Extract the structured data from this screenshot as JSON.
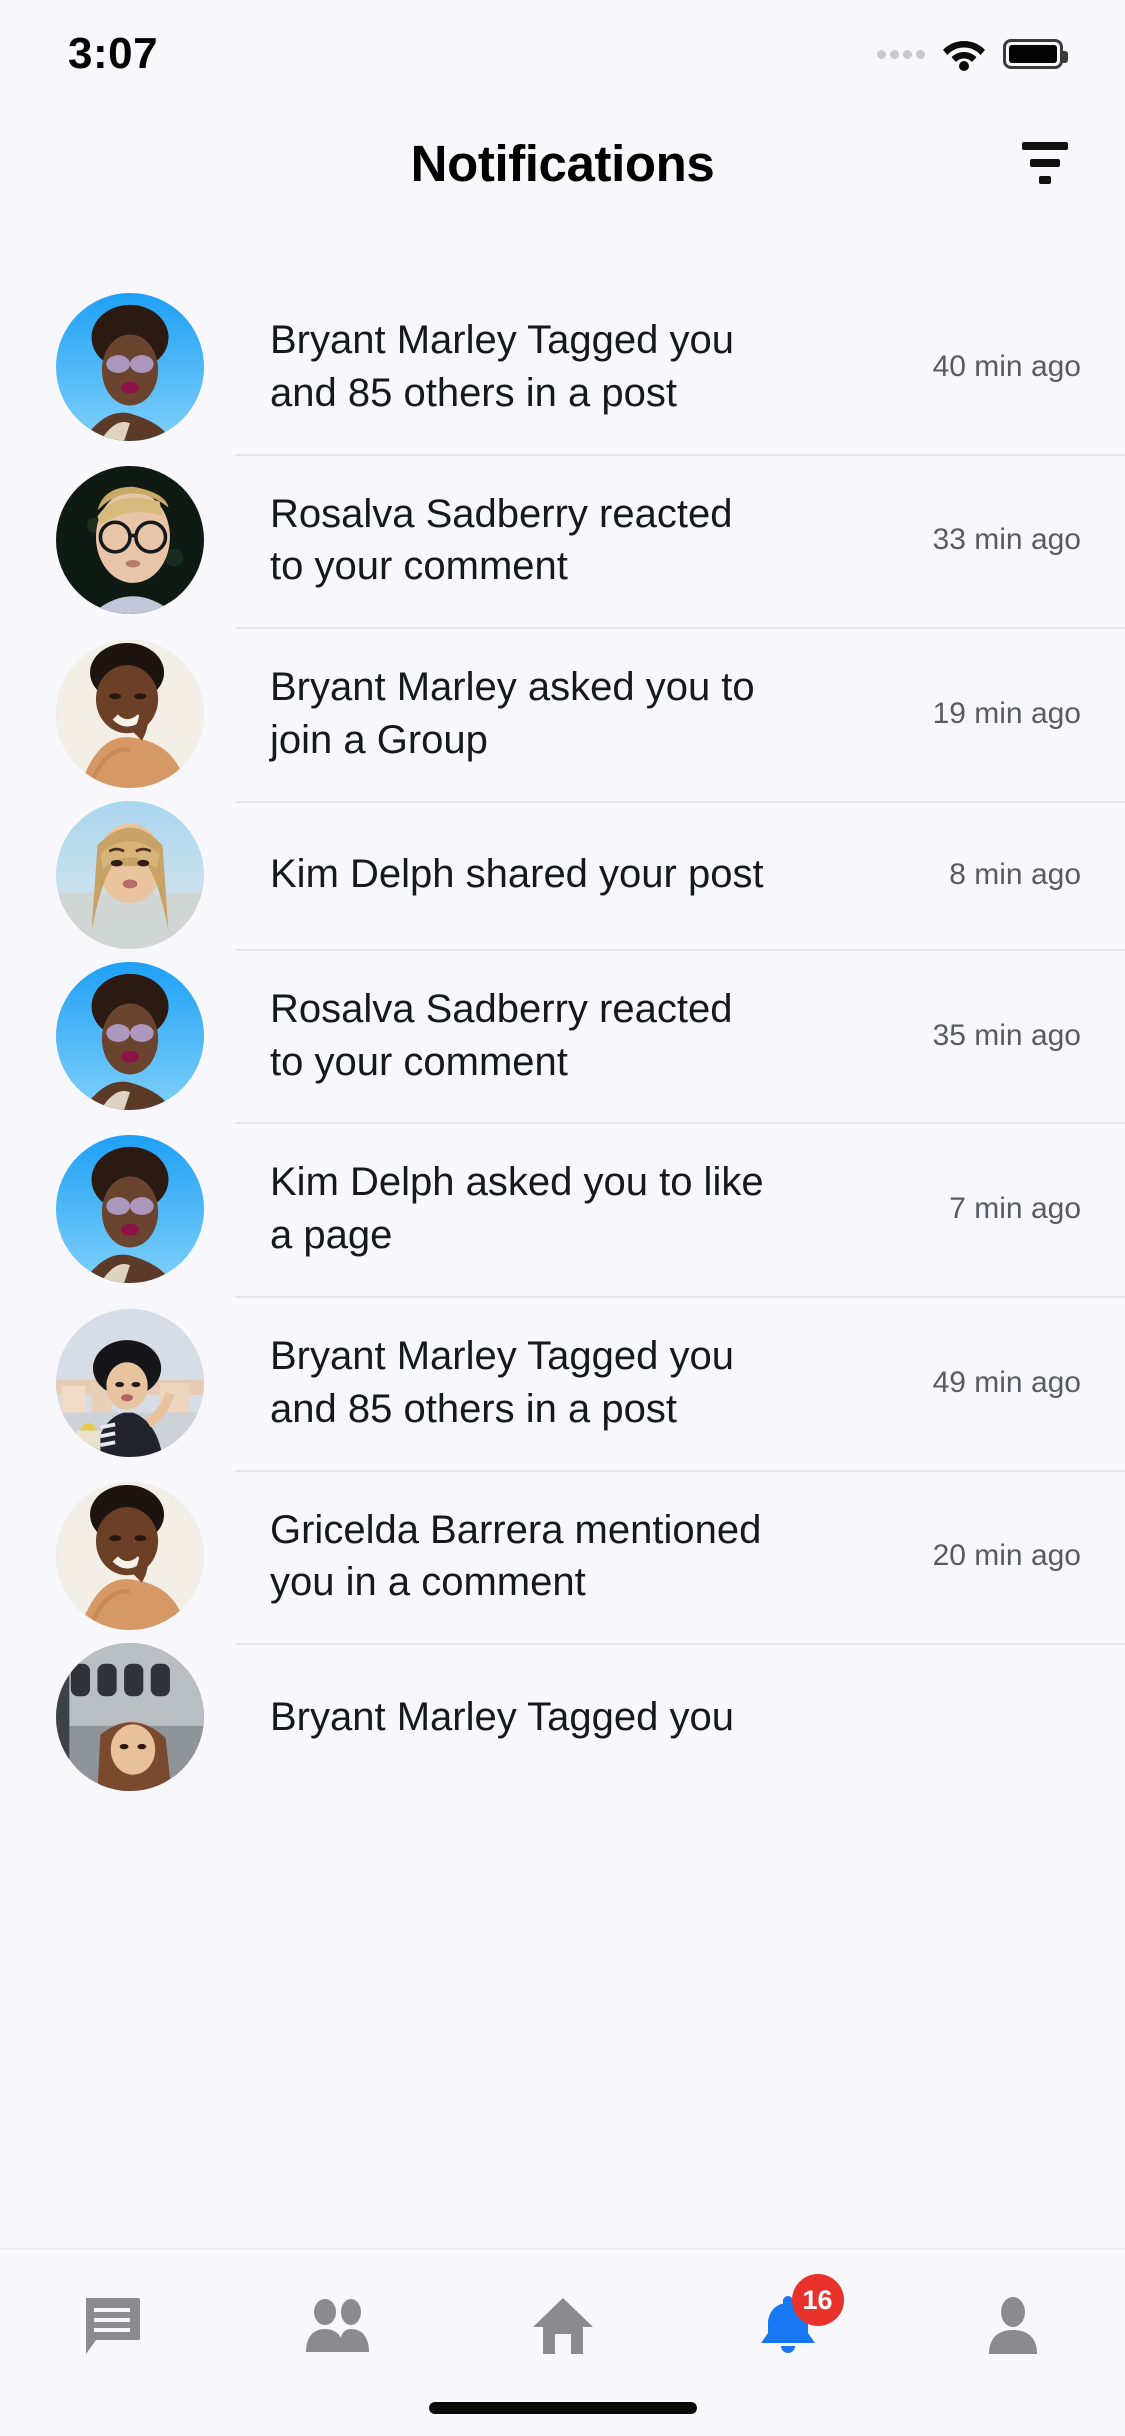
{
  "status_bar": {
    "time": "3:07",
    "signal_icon": "signal-dots-icon",
    "wifi_icon": "wifi-icon",
    "battery_icon": "battery-full-icon"
  },
  "header": {
    "title": "Notifications",
    "filter_icon": "filter-icon"
  },
  "notifications": [
    {
      "text": "Bryant Marley Tagged you and 85 others in a post",
      "time": "40 min ago",
      "avatar": "woman-sunglasses-blue-sky"
    },
    {
      "text": "Rosalva Sadberry reacted to your comment",
      "time": "33 min ago",
      "avatar": "man-glasses-dark-bg"
    },
    {
      "text": "Bryant Marley asked you to join a Group",
      "time": "19 min ago",
      "avatar": "woman-tan-sweater-cream-bg"
    },
    {
      "text": "Kim Delph shared your post",
      "time": "8 min ago",
      "avatar": "woman-long-blonde-hair-blue-bg"
    },
    {
      "text": "Rosalva Sadberry reacted to your comment",
      "time": "35 min ago",
      "avatar": "woman-sunglasses-blue-sky"
    },
    {
      "text": "Kim Delph asked you to like a page",
      "time": "7 min ago",
      "avatar": "woman-sunglasses-blue-sky"
    },
    {
      "text": "Bryant Marley Tagged you and 85 others in a post",
      "time": "49 min ago",
      "avatar": "woman-black-hat-rooftop"
    },
    {
      "text": "Gricelda Barrera mentioned you in a comment",
      "time": "20 min ago",
      "avatar": "woman-tan-sweater-cream-bg"
    },
    {
      "text": "Bryant Marley Tagged you",
      "time": "",
      "avatar": "woman-train-station-gray"
    }
  ],
  "tabbar": {
    "items": [
      {
        "name": "messages",
        "icon": "chat-bubble-icon",
        "active": false
      },
      {
        "name": "friends",
        "icon": "people-icon",
        "active": false
      },
      {
        "name": "home",
        "icon": "home-icon",
        "active": false
      },
      {
        "name": "notifications",
        "icon": "bell-icon",
        "active": true,
        "badge": "16"
      },
      {
        "name": "profile",
        "icon": "person-icon",
        "active": false
      }
    ],
    "active_color": "#1877F2",
    "inactive_color": "#8A8A8F",
    "badge_color": "#E8322A"
  },
  "theme": {
    "background": "#F8F8FC",
    "text_primary": "#16181C",
    "text_secondary": "#5A5A63",
    "divider": "#E6E6EC"
  }
}
